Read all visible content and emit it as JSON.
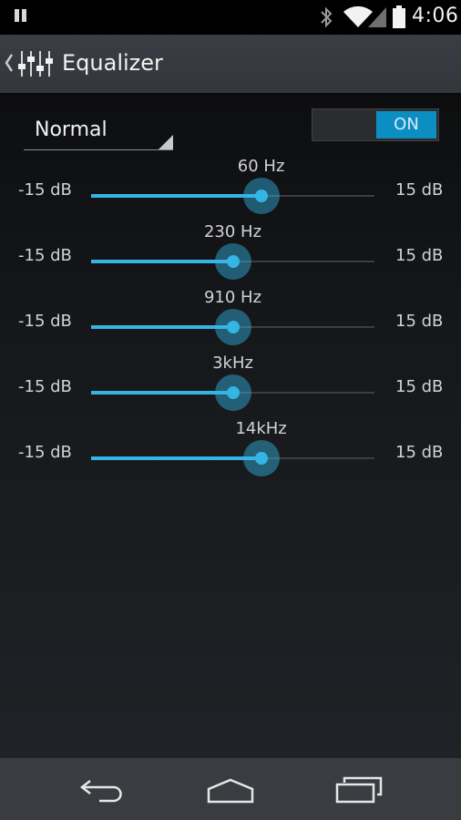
{
  "status_bar": {
    "time": "4:06",
    "icons": [
      "pause-icon",
      "bluetooth-icon",
      "wifi-icon",
      "signal-icon",
      "battery-icon"
    ]
  },
  "action_bar": {
    "title": "Equalizer",
    "icons": [
      "back-caret-icon",
      "equalizer-app-icon"
    ]
  },
  "preset": {
    "value": "Normal"
  },
  "toggle": {
    "label": "ON",
    "checked": true
  },
  "bands": [
    {
      "label": "60 Hz",
      "min_label": "-15 dB",
      "max_label": "15 dB",
      "level": 0.6
    },
    {
      "label": "230 Hz",
      "min_label": "-15 dB",
      "max_label": "15 dB",
      "level": 0.5
    },
    {
      "label": "910 Hz",
      "min_label": "-15 dB",
      "max_label": "15 dB",
      "level": 0.5
    },
    {
      "label": "3kHz",
      "min_label": "-15 dB",
      "max_label": "15 dB",
      "level": 0.5
    },
    {
      "label": "14kHz",
      "min_label": "-15 dB",
      "max_label": "15 dB",
      "level": 0.6
    }
  ],
  "nav_bar": {
    "buttons": [
      "back-icon",
      "home-icon",
      "recents-icon"
    ]
  },
  "colors": {
    "accent": "#35b5e5",
    "toggle_on": "#0c8ec3",
    "action_bar": "#3a3e44",
    "nav_bar": "#393c40"
  }
}
